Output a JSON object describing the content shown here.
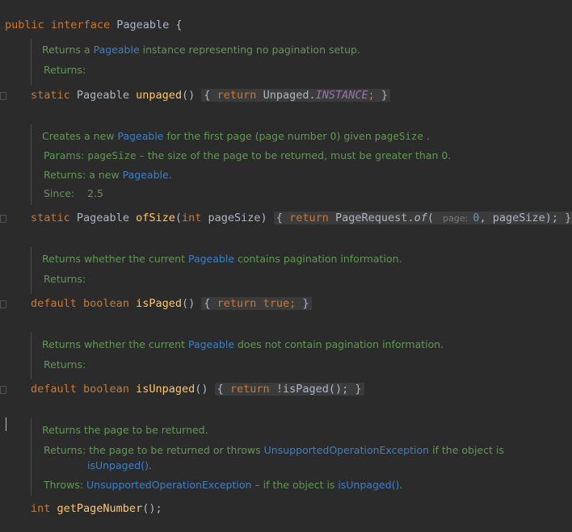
{
  "header": {
    "kw1": "public",
    "kw2": "interface",
    "name": "Pageable",
    "brace": "{"
  },
  "methods": [
    {
      "doc": {
        "summary_pre": "Returns a ",
        "summary_link": "Pageable",
        "summary_post": " instance representing no pagination setup.",
        "returns_label": "Returns:"
      },
      "sig": {
        "mod": "static",
        "type": "Pageable",
        "name": "unpaged",
        "params": "()",
        "body_kw": "return",
        "body_cls": "Unpaged.",
        "body_const": "INSTANCE",
        "body_end": ";"
      }
    },
    {
      "doc": {
        "summary_pre": "Creates a new ",
        "summary_link": "Pageable",
        "summary_mid": " for the first page (page number ",
        "summary_num": "0",
        "summary_mid2": ") given ",
        "summary_code": "pageSize",
        "summary_post": " .",
        "params_label": "Params:",
        "params_code": "pageSize",
        "params_text": " – the size of the page to be returned, must be greater than 0.",
        "returns_label": "Returns:",
        "returns_pre": "a new ",
        "returns_link": "Pageable",
        "returns_post": ".",
        "since_label": "Since:",
        "since_value": "2.5"
      },
      "sig": {
        "mod": "static",
        "type": "Pageable",
        "name": "ofSize",
        "params_open": "(",
        "param_kw": "int",
        "param_name": " pageSize)",
        "body_kw": "return",
        "body_cls": "PageRequest.",
        "body_call": "of",
        "paren": "(",
        "hint": "page:",
        "arg_num": "0",
        "arg_rest": ", pageSize);"
      }
    },
    {
      "doc": {
        "summary_pre": "Returns whether the current ",
        "summary_link": "Pageable",
        "summary_post": " contains pagination information.",
        "returns_label": "Returns:"
      },
      "sig": {
        "mod": "default",
        "type": "boolean",
        "name": "isPaged",
        "params": "()",
        "body_kw": "return",
        "body_val": "true",
        "body_end": ";"
      }
    },
    {
      "doc": {
        "summary_pre": "Returns whether the current ",
        "summary_link": "Pageable",
        "summary_post": " does not contain pagination information.",
        "returns_label": "Returns:"
      },
      "sig": {
        "mod": "default",
        "type": "boolean",
        "name": "isUnpaged",
        "params": "()",
        "body_kw": "return",
        "body_expr": "!isPaged();"
      }
    },
    {
      "doc": {
        "summary": "Returns the page to be returned.",
        "returns_label": "Returns:",
        "returns_pre": "the page to be returned or throws ",
        "returns_link": "UnsupportedOperationException",
        "returns_post": " if the object is",
        "returns_link2": "isUnpaged()",
        "returns_end": ".",
        "throws_label": "Throws:",
        "throws_link": "UnsupportedOperationException",
        "throws_mid": " – if the object is ",
        "throws_link2": "isUnpaged()",
        "throws_end": "."
      },
      "sig": {
        "type": "int",
        "name": "getPageNumber",
        "rest": "();"
      }
    }
  ]
}
